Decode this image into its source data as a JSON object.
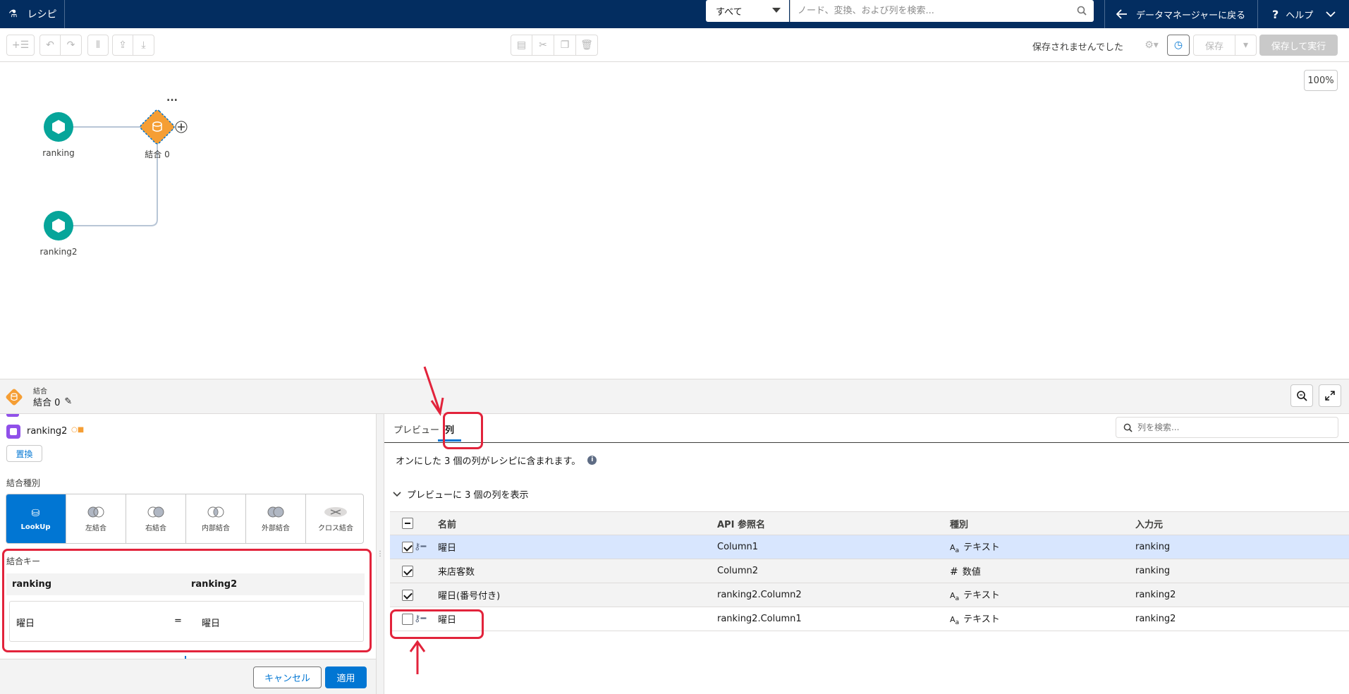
{
  "topbar": {
    "app_title": "レシピ",
    "scope": "すべて",
    "search_placeholder": "ノード、変換、および列を検索...",
    "back_label": "データマネージャーに戻る",
    "help_label": "ヘルプ"
  },
  "toolbar": {
    "save_status": "保存されませんでした",
    "save_label": "保存",
    "save_run_label": "保存して実行"
  },
  "canvas": {
    "zoom": "100%",
    "nodes": [
      {
        "label": "ranking",
        "kind": "input"
      },
      {
        "label": "結合 0",
        "kind": "join"
      },
      {
        "label": "ranking2",
        "kind": "input"
      }
    ],
    "more_label": "..."
  },
  "panel": {
    "type_label": "結合",
    "node_name": "結合 0"
  },
  "left": {
    "dataset_name": "ranking2",
    "replace_label": "置換",
    "join_type_title": "結合種別",
    "join_types": [
      "LookUp",
      "左結合",
      "右結合",
      "内部結合",
      "外部結合",
      "クロス結合"
    ],
    "join_keys_title": "結合キー",
    "key_header_left": "ranking",
    "key_header_right": "ranking2",
    "key_left": "曜日",
    "key_eq": "=",
    "key_right": "曜日",
    "cancel_label": "キャンセル",
    "apply_label": "適用"
  },
  "right": {
    "tabs": [
      "プレビュー",
      "列"
    ],
    "active_tab": "列",
    "search_placeholder": "列を検索...",
    "info_text": "オンにした 3 個の列がレシピに含まれます。",
    "section_title": "プレビューに 3 個の列を表示",
    "headers": [
      "名前",
      "API 参照名",
      "種別",
      "入力元"
    ],
    "rows": [
      {
        "checked": true,
        "key": true,
        "name": "曜日",
        "api": "Column1",
        "type": "テキスト",
        "type_icon": "text",
        "source": "ranking",
        "selected": true
      },
      {
        "checked": true,
        "key": false,
        "name": "来店客数",
        "api": "Column2",
        "type": "数値",
        "type_icon": "number",
        "source": "ranking",
        "selected": false
      },
      {
        "checked": true,
        "key": false,
        "name": "曜日(番号付き)",
        "api": "ranking2.Column2",
        "type": "テキスト",
        "type_icon": "text",
        "source": "ranking2",
        "selected": false
      },
      {
        "checked": false,
        "key": true,
        "name": "曜日",
        "api": "ranking2.Column1",
        "type": "テキスト",
        "type_icon": "text",
        "source": "ranking2",
        "selected": false
      }
    ]
  },
  "colors": {
    "topbar": "#032d60",
    "brand": "#0176d3",
    "input_node": "#06a59a",
    "join_node": "#f59e34",
    "annotation": "#e2233b",
    "selected_row": "#d8e6fe"
  }
}
